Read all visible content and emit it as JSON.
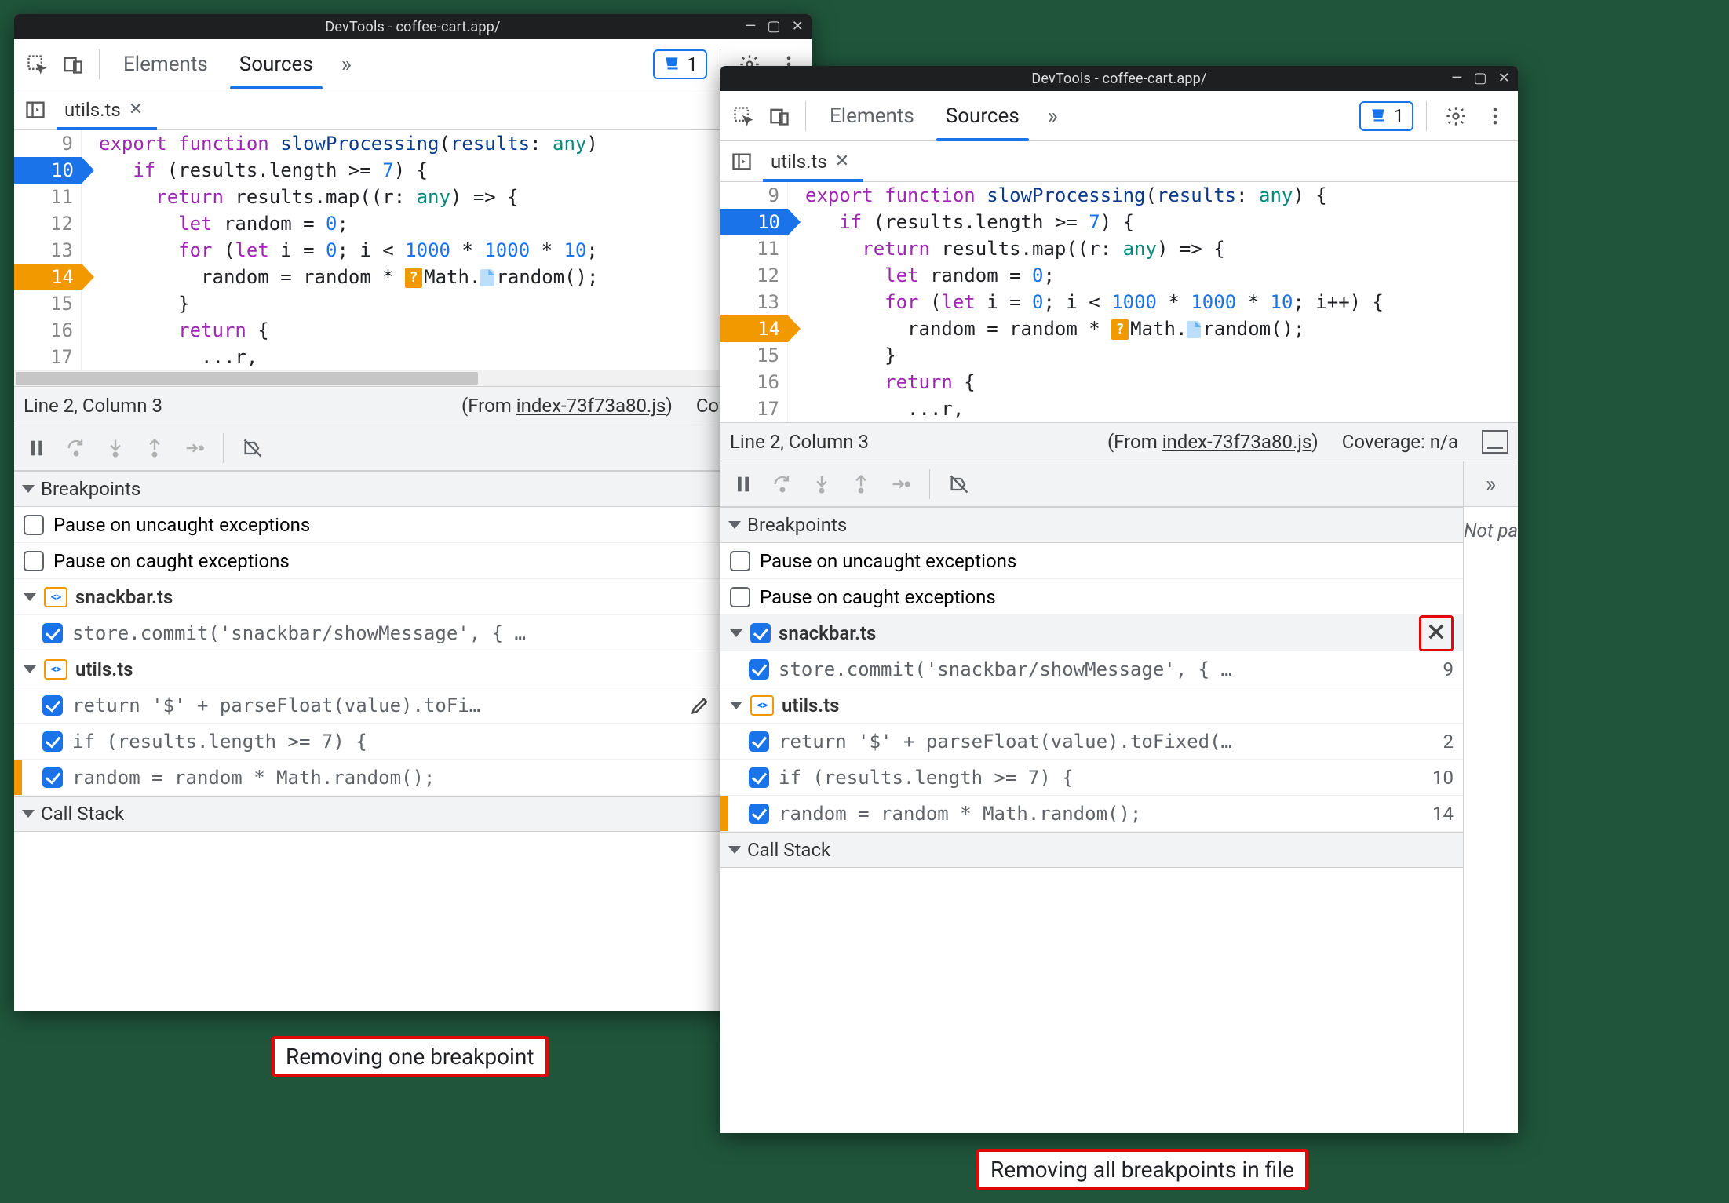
{
  "titlebar": {
    "title": "DevTools - coffee-cart.app/"
  },
  "tabs": {
    "elements": "Elements",
    "sources": "Sources",
    "more": "»",
    "issues_count": "1"
  },
  "file_tab": {
    "name": "utils.ts"
  },
  "code": {
    "lines": {
      "l9": "9",
      "l10": "10",
      "l11": "11",
      "l12": "12",
      "l13": "13",
      "l14": "14",
      "l15": "15",
      "l16": "16",
      "l17": "17"
    },
    "text": {
      "l9_export": "export",
      "l9_function": "function",
      "l9_name": "slowProcessing",
      "l9_params_open": "(",
      "l9_param": "results",
      "l9_colon": ": ",
      "l9_any": "any",
      "l9_rest_a": ") {",
      "l9_rest_b": ")",
      "l10_if": "if",
      "l10_rest": " (results.length >= ",
      "l10_num": "7",
      "l10_close": ") {",
      "l11_return": "return",
      "l11_rest": " results.map((r: ",
      "l11_any": "any",
      "l11_close": ") => {",
      "l12_let": "let",
      "l12_var": " random = ",
      "l12_num": "0",
      "l12_semi": ";",
      "l13_for": "for",
      "l13_open": " (",
      "l13_let": "let",
      "l13_ivar": " i = ",
      "l13_z": "0",
      "l13_cond": "; i < ",
      "l13_a": "1000",
      "l13_m1": " * ",
      "l13_b": "1000",
      "l13_m2": " * ",
      "l13_c": "10",
      "l13_tail_a": ";",
      "l13_tail_b": "; i++) {",
      "l14_pre": "random = random * ",
      "l14_math": "Math.",
      "l14_rand": "random();",
      "l15_brace": "}",
      "l16_return": "return",
      "l16_brace": " {",
      "l17": "...r,"
    }
  },
  "status": {
    "pos": "Line 2, Column 3",
    "from_label": "(From ",
    "from_file": "index-73f73a80.js",
    "from_close": ")",
    "coverage_a": "Coverage: n/",
    "coverage_b": "Coverage: n/a"
  },
  "breakpoints": {
    "section_title": "Breakpoints",
    "uncaught": "Pause on uncaught exceptions",
    "caught": "Pause on caught exceptions",
    "files": {
      "snackbar": "snackbar.ts",
      "utils": "utils.ts"
    },
    "items": {
      "snackbar1": {
        "code": "store.commit('snackbar/showMessage', { …",
        "line": "9"
      },
      "utils1": {
        "code": "return '$' + parseFloat(value).toFi…",
        "line": "2"
      },
      "utils1b": {
        "code": "return '$' + parseFloat(value).toFixed(…",
        "line": "2"
      },
      "utils2": {
        "code": "if (results.length >= 7) {",
        "line": "10"
      },
      "utils3": {
        "code": "random = random * Math.random();",
        "line": "14"
      }
    }
  },
  "callstack": {
    "title": "Call Stack"
  },
  "side": {
    "notpaused": "Not pa"
  },
  "captions": {
    "left": "Removing one breakpoint",
    "right": "Removing all breakpoints in file"
  }
}
